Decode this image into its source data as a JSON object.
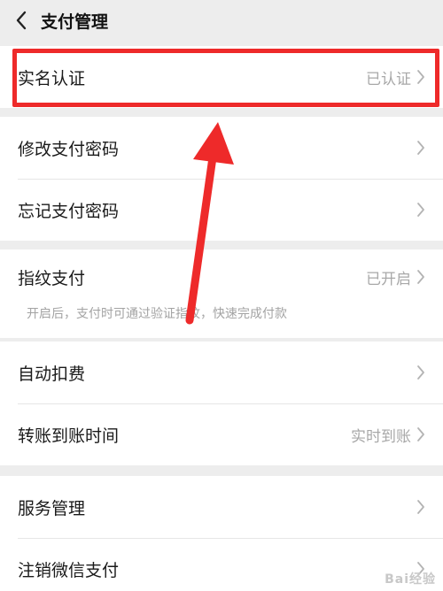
{
  "header": {
    "title": "支付管理"
  },
  "groups": [
    {
      "rows": [
        {
          "label": "实名认证",
          "value": "已认证"
        }
      ]
    },
    {
      "rows": [
        {
          "label": "修改支付密码",
          "value": ""
        },
        {
          "label": "忘记支付密码",
          "value": ""
        }
      ]
    },
    {
      "rows": [
        {
          "label": "指纹支付",
          "value": "已开启",
          "sub": "开启后，支付时可通过验证指纹，快速完成付款"
        }
      ]
    },
    {
      "rows": [
        {
          "label": "自动扣费",
          "value": ""
        },
        {
          "label": "转账到账时间",
          "value": "实时到账"
        }
      ]
    },
    {
      "rows": [
        {
          "label": "服务管理",
          "value": ""
        },
        {
          "label": "注销微信支付",
          "value": ""
        }
      ]
    }
  ],
  "watermark": "Bai经验",
  "colors": {
    "annotation": "#ee2a2a",
    "background": "#ededed",
    "secondary_text": "#a8a8a8"
  }
}
